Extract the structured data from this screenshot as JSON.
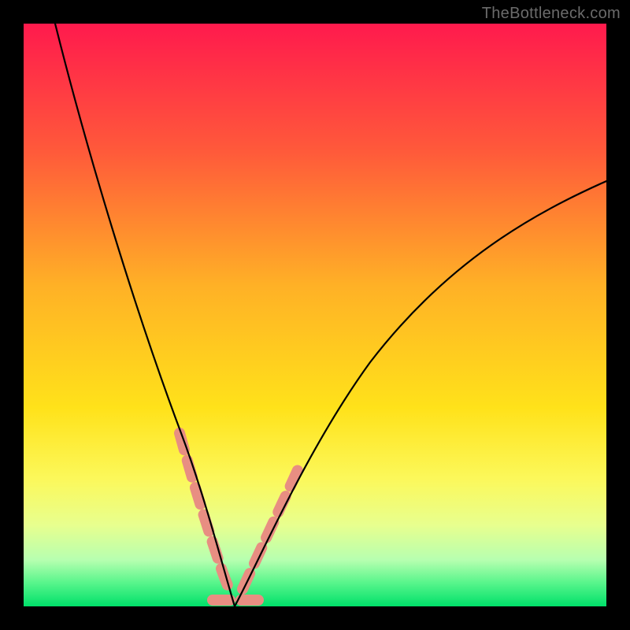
{
  "watermark": "TheBottleneck.com",
  "chart_data": {
    "type": "line",
    "title": "",
    "xlabel": "",
    "ylabel": "",
    "x_range": [
      0,
      100
    ],
    "y_range": [
      0,
      100
    ],
    "grid": false,
    "legend": "none",
    "background_gradient_stops": [
      {
        "offset": 0.0,
        "color": "#ff1a4d"
      },
      {
        "offset": 0.22,
        "color": "#ff5a3a"
      },
      {
        "offset": 0.45,
        "color": "#ffb126"
      },
      {
        "offset": 0.66,
        "color": "#ffe21a"
      },
      {
        "offset": 0.78,
        "color": "#fcf85a"
      },
      {
        "offset": 0.86,
        "color": "#e8ff8e"
      },
      {
        "offset": 0.92,
        "color": "#b7ffb0"
      },
      {
        "offset": 0.96,
        "color": "#57f58b"
      },
      {
        "offset": 1.0,
        "color": "#00e06a"
      }
    ],
    "series": [
      {
        "name": "left",
        "color": "#000000",
        "x": [
          5,
          8,
          11,
          14,
          17,
          20,
          23,
          26,
          28,
          30,
          32,
          33.5,
          35,
          36
        ],
        "y": [
          100,
          92,
          83,
          74,
          64,
          55,
          45,
          35,
          27,
          19,
          12,
          7,
          3,
          0
        ]
      },
      {
        "name": "right",
        "color": "#000000",
        "x": [
          36,
          38,
          41,
          45,
          50,
          56,
          63,
          71,
          80,
          90,
          100
        ],
        "y": [
          0,
          4,
          10,
          18,
          27,
          36,
          45,
          53,
          60,
          67,
          73
        ]
      }
    ],
    "highlight_salmon_dashes": {
      "color": "#e88e82",
      "left_segment": {
        "x_start": 27,
        "y_start": 30,
        "x_end": 35,
        "y_end": 3
      },
      "right_segment": {
        "x_start": 37,
        "y_start": 3,
        "x_end": 47,
        "y_end": 22
      },
      "bottom_segment": {
        "x_start": 32,
        "y_start": 1,
        "x_end": 40,
        "y_end": 1
      }
    }
  }
}
